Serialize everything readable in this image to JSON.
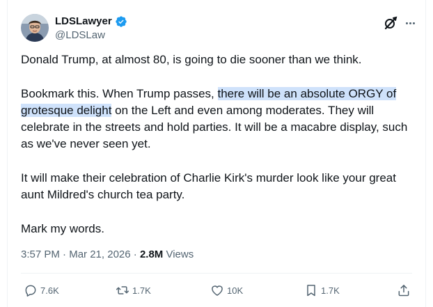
{
  "tweet": {
    "author": {
      "display_name": "LDSLawyer",
      "handle": "@LDSLaw",
      "verified": true
    },
    "body": {
      "para1": "Donald Trump, at almost 80, is going to die sooner than we think.",
      "para2_before": "Bookmark this. When Trump passes, ",
      "para2_highlight": "there will be an absolute ORGY of grotesque delight",
      "para2_after": " on the Left and even among moderates. They will celebrate in the streets and hold parties. It will be a macabre display, such as we've never seen yet.",
      "para3": "It will make their celebration of Charlie Kirk's murder look like your great aunt Mildred's church tea party.",
      "para4": "Mark my words."
    },
    "meta": {
      "time": "3:57 PM",
      "separator1": " · ",
      "date": "Mar 21, 2026",
      "separator2": " · ",
      "views_count": "2.8M",
      "views_label": " Views"
    },
    "actions": {
      "replies": "7.6K",
      "reposts": "1.7K",
      "likes": "10K",
      "bookmarks": "1.7K"
    }
  },
  "icons": {
    "verified": "verified-badge-icon",
    "grok": "grok-icon",
    "more": "more-dots-icon",
    "reply": "reply-icon",
    "repost": "repost-icon",
    "like": "heart-icon",
    "bookmark": "bookmark-icon",
    "share": "share-icon"
  },
  "colors": {
    "text": "#0f1419",
    "secondary": "#536471",
    "verified_blue": "#1d9bf0",
    "highlight": "#cfe2fb"
  }
}
